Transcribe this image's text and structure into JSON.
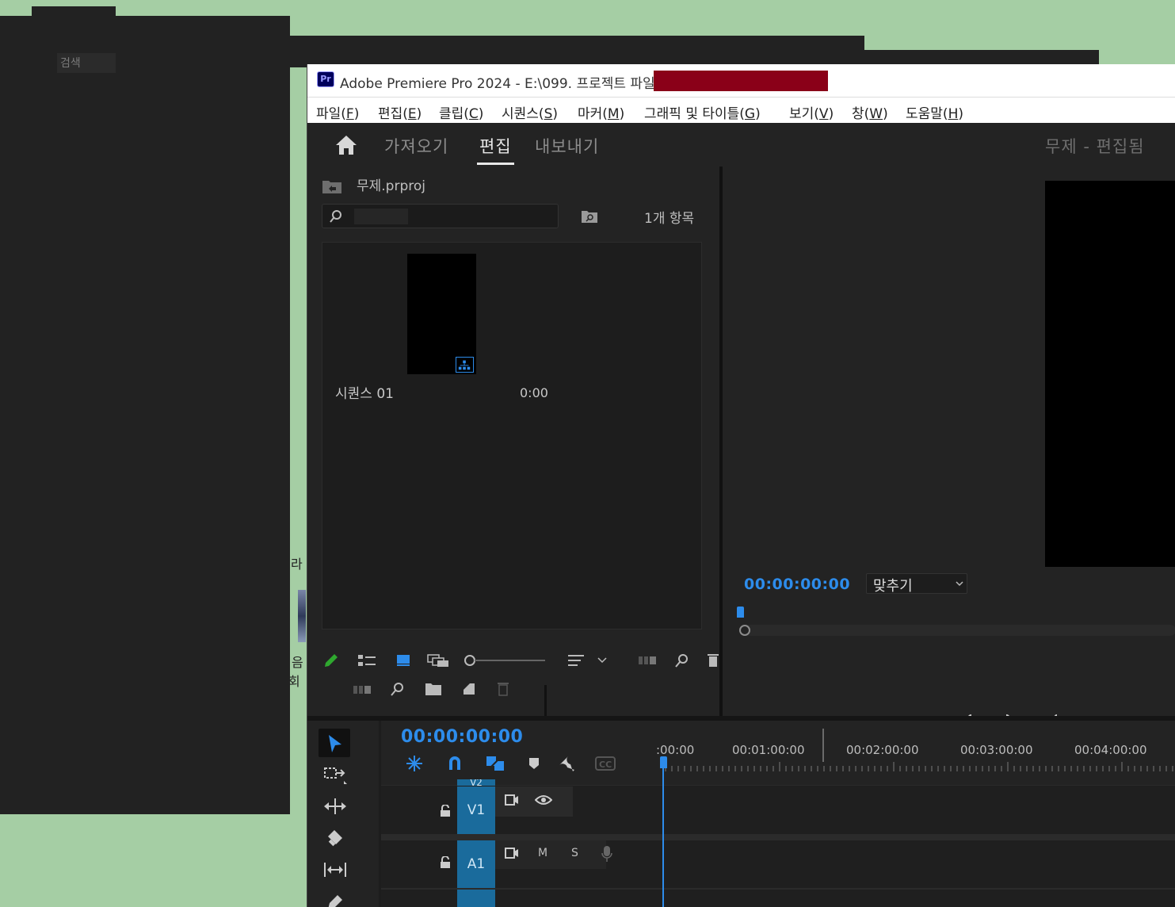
{
  "background": {
    "search_placeholder": "검색",
    "partial_text_1": "라",
    "partial_text_2": "음",
    "partial_text_3": "회"
  },
  "window": {
    "app_icon": "Pr",
    "title": "Adobe Premiere Pro 2024 - E:\\099. 프로젝트 파일\\"
  },
  "menu": [
    {
      "label": "파일(",
      "key": "F",
      "end": ")"
    },
    {
      "label": "편집(",
      "key": "E",
      "end": ")"
    },
    {
      "label": "클립(",
      "key": "C",
      "end": ")"
    },
    {
      "label": "시퀀스(",
      "key": "S",
      "end": ")"
    },
    {
      "label": "마커(",
      "key": "M",
      "end": ")"
    },
    {
      "label": "그래픽 및 타이틀(",
      "key": "G",
      "end": ")"
    },
    {
      "label": "보기(",
      "key": "V",
      "end": ")"
    },
    {
      "label": "창(",
      "key": "W",
      "end": ")"
    },
    {
      "label": "도움말(",
      "key": "H",
      "end": ")"
    }
  ],
  "workspace": {
    "tabs": [
      "가져오기",
      "편집",
      "내보내기"
    ],
    "active_tab": "편집",
    "project_status": "무제 - 편집됨"
  },
  "project": {
    "name": "무제.prproj",
    "search_value": "",
    "item_count": "1개 항목",
    "items": [
      {
        "name": "시퀀스 01",
        "duration": "0:00"
      }
    ]
  },
  "program": {
    "timecode": "00:00:00:00",
    "fit_value": "맞추기"
  },
  "timeline": {
    "timecode": "00:00:00:00",
    "ruler": [
      ":00:00",
      "00:01:00:00",
      "00:02:00:00",
      "00:03:00:00",
      "00:04:00:00"
    ],
    "tracks": {
      "v2": "V2",
      "v1": "V1",
      "a1": "A1",
      "mute": "M",
      "solo": "S"
    }
  },
  "colors": {
    "accent": "#2d8ceb",
    "track_label": "#1a6b9c",
    "panel_bg": "#232323",
    "desktop": "#a5cea4",
    "redaction": "#8a0018"
  }
}
